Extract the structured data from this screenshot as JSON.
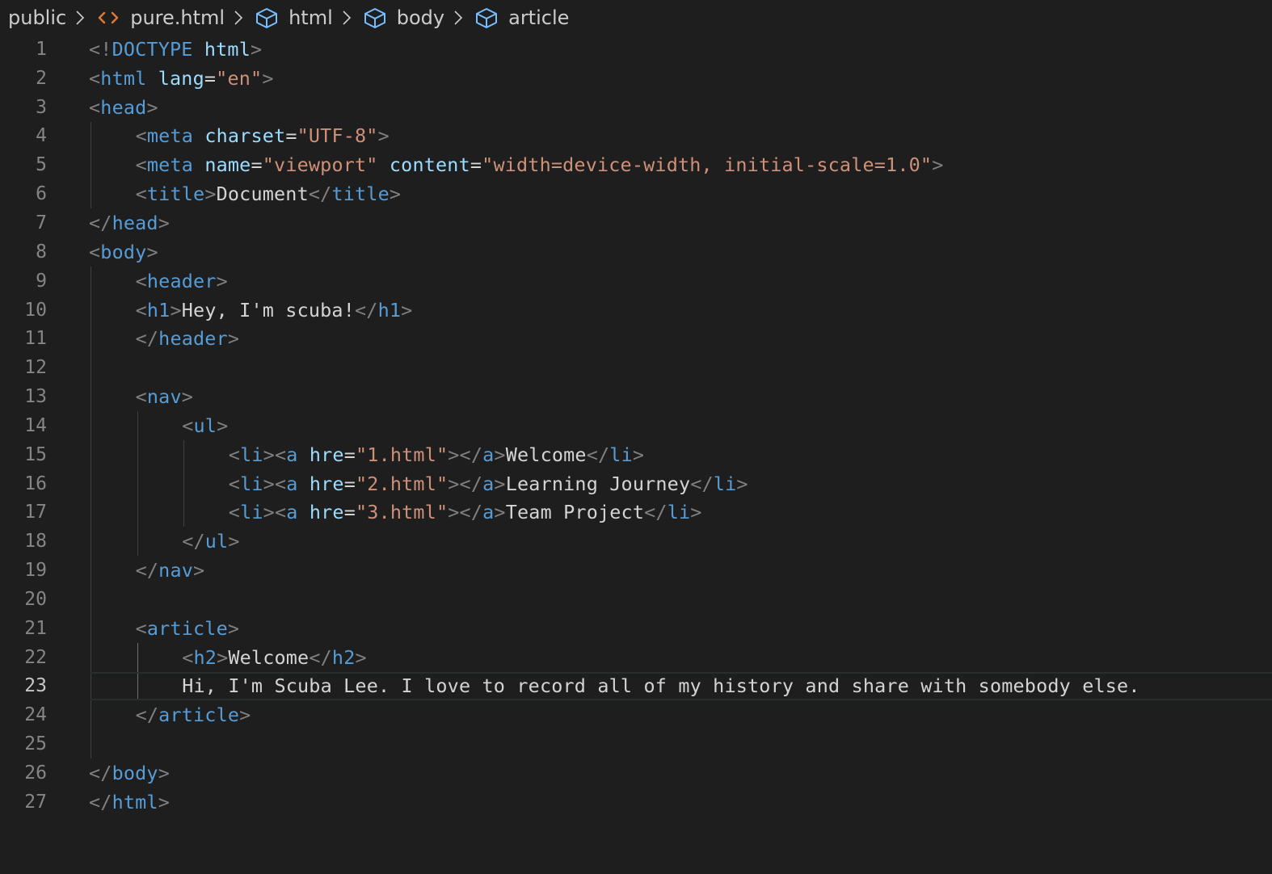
{
  "breadcrumb": {
    "items": [
      {
        "label": "public",
        "icon": "none"
      },
      {
        "label": "pure.html",
        "icon": "html-file-icon"
      },
      {
        "label": "html",
        "icon": "symbol-element-icon"
      },
      {
        "label": "body",
        "icon": "symbol-element-icon"
      },
      {
        "label": "article",
        "icon": "symbol-element-icon"
      }
    ]
  },
  "colors": {
    "background": "#1e1e1e",
    "tag": "#569cd6",
    "attribute": "#9cdcfe",
    "string": "#ce9178",
    "punctuation": "#808080",
    "text": "#d4d4d4",
    "line_number": "#858585",
    "html_icon": "#e37933",
    "symbol_icon": "#75beff"
  },
  "editor": {
    "current_line": 23,
    "lines": [
      {
        "n": "1",
        "indent": 0,
        "tokens": [
          [
            "p",
            "<!"
          ],
          [
            "t",
            "DOCTYPE"
          ],
          [
            "x",
            " "
          ],
          [
            "a",
            "html"
          ],
          [
            "p",
            ">"
          ]
        ]
      },
      {
        "n": "2",
        "indent": 0,
        "tokens": [
          [
            "p",
            "<"
          ],
          [
            "t",
            "html"
          ],
          [
            "x",
            " "
          ],
          [
            "a",
            "lang"
          ],
          [
            "x",
            "="
          ],
          [
            "s",
            "\"en\""
          ],
          [
            "p",
            ">"
          ]
        ]
      },
      {
        "n": "3",
        "indent": 0,
        "tokens": [
          [
            "p",
            "<"
          ],
          [
            "t",
            "head"
          ],
          [
            "p",
            ">"
          ]
        ]
      },
      {
        "n": "4",
        "indent": 1,
        "tokens": [
          [
            "p",
            "<"
          ],
          [
            "t",
            "meta"
          ],
          [
            "x",
            " "
          ],
          [
            "a",
            "charset"
          ],
          [
            "x",
            "="
          ],
          [
            "s",
            "\"UTF-8\""
          ],
          [
            "p",
            ">"
          ]
        ]
      },
      {
        "n": "5",
        "indent": 1,
        "tokens": [
          [
            "p",
            "<"
          ],
          [
            "t",
            "meta"
          ],
          [
            "x",
            " "
          ],
          [
            "a",
            "name"
          ],
          [
            "x",
            "="
          ],
          [
            "s",
            "\"viewport\""
          ],
          [
            "x",
            " "
          ],
          [
            "a",
            "content"
          ],
          [
            "x",
            "="
          ],
          [
            "s",
            "\"width=device-width, initial-scale=1.0\""
          ],
          [
            "p",
            ">"
          ]
        ]
      },
      {
        "n": "6",
        "indent": 1,
        "tokens": [
          [
            "p",
            "<"
          ],
          [
            "t",
            "title"
          ],
          [
            "p",
            ">"
          ],
          [
            "x",
            "Document"
          ],
          [
            "p",
            "</"
          ],
          [
            "t",
            "title"
          ],
          [
            "p",
            ">"
          ]
        ]
      },
      {
        "n": "7",
        "indent": 0,
        "tokens": [
          [
            "p",
            "</"
          ],
          [
            "t",
            "head"
          ],
          [
            "p",
            ">"
          ]
        ]
      },
      {
        "n": "8",
        "indent": 0,
        "tokens": [
          [
            "p",
            "<"
          ],
          [
            "t",
            "body"
          ],
          [
            "p",
            ">"
          ]
        ]
      },
      {
        "n": "9",
        "indent": 1,
        "tokens": [
          [
            "p",
            "<"
          ],
          [
            "t",
            "header"
          ],
          [
            "p",
            ">"
          ]
        ]
      },
      {
        "n": "10",
        "indent": 1,
        "tokens": [
          [
            "p",
            "<"
          ],
          [
            "t",
            "h1"
          ],
          [
            "p",
            ">"
          ],
          [
            "x",
            "Hey, I'm scuba!"
          ],
          [
            "p",
            "</"
          ],
          [
            "t",
            "h1"
          ],
          [
            "p",
            ">"
          ]
        ]
      },
      {
        "n": "11",
        "indent": 1,
        "tokens": [
          [
            "p",
            "</"
          ],
          [
            "t",
            "header"
          ],
          [
            "p",
            ">"
          ]
        ]
      },
      {
        "n": "12",
        "indent": 1,
        "tokens": []
      },
      {
        "n": "13",
        "indent": 1,
        "tokens": [
          [
            "p",
            "<"
          ],
          [
            "t",
            "nav"
          ],
          [
            "p",
            ">"
          ]
        ]
      },
      {
        "n": "14",
        "indent": 2,
        "tokens": [
          [
            "p",
            "<"
          ],
          [
            "t",
            "ul"
          ],
          [
            "p",
            ">"
          ]
        ]
      },
      {
        "n": "15",
        "indent": 3,
        "tokens": [
          [
            "p",
            "<"
          ],
          [
            "t",
            "li"
          ],
          [
            "p",
            "><"
          ],
          [
            "t",
            "a"
          ],
          [
            "x",
            " "
          ],
          [
            "a",
            "hre"
          ],
          [
            "x",
            "="
          ],
          [
            "s",
            "\"1.html\""
          ],
          [
            "p",
            "></"
          ],
          [
            "t",
            "a"
          ],
          [
            "p",
            ">"
          ],
          [
            "x",
            "Welcome"
          ],
          [
            "p",
            "</"
          ],
          [
            "t",
            "li"
          ],
          [
            "p",
            ">"
          ]
        ]
      },
      {
        "n": "16",
        "indent": 3,
        "tokens": [
          [
            "p",
            "<"
          ],
          [
            "t",
            "li"
          ],
          [
            "p",
            "><"
          ],
          [
            "t",
            "a"
          ],
          [
            "x",
            " "
          ],
          [
            "a",
            "hre"
          ],
          [
            "x",
            "="
          ],
          [
            "s",
            "\"2.html\""
          ],
          [
            "p",
            "></"
          ],
          [
            "t",
            "a"
          ],
          [
            "p",
            ">"
          ],
          [
            "x",
            "Learning Journey"
          ],
          [
            "p",
            "</"
          ],
          [
            "t",
            "li"
          ],
          [
            "p",
            ">"
          ]
        ]
      },
      {
        "n": "17",
        "indent": 3,
        "tokens": [
          [
            "p",
            "<"
          ],
          [
            "t",
            "li"
          ],
          [
            "p",
            "><"
          ],
          [
            "t",
            "a"
          ],
          [
            "x",
            " "
          ],
          [
            "a",
            "hre"
          ],
          [
            "x",
            "="
          ],
          [
            "s",
            "\"3.html\""
          ],
          [
            "p",
            "></"
          ],
          [
            "t",
            "a"
          ],
          [
            "p",
            ">"
          ],
          [
            "x",
            "Team Project"
          ],
          [
            "p",
            "</"
          ],
          [
            "t",
            "li"
          ],
          [
            "p",
            ">"
          ]
        ]
      },
      {
        "n": "18",
        "indent": 2,
        "tokens": [
          [
            "p",
            "</"
          ],
          [
            "t",
            "ul"
          ],
          [
            "p",
            ">"
          ]
        ]
      },
      {
        "n": "19",
        "indent": 1,
        "tokens": [
          [
            "p",
            "</"
          ],
          [
            "t",
            "nav"
          ],
          [
            "p",
            ">"
          ]
        ]
      },
      {
        "n": "20",
        "indent": 1,
        "tokens": []
      },
      {
        "n": "21",
        "indent": 1,
        "tokens": [
          [
            "p",
            "<"
          ],
          [
            "t",
            "article"
          ],
          [
            "p",
            ">"
          ]
        ]
      },
      {
        "n": "22",
        "indent": 2,
        "tokens": [
          [
            "p",
            "<"
          ],
          [
            "t",
            "h2"
          ],
          [
            "p",
            ">"
          ],
          [
            "x",
            "Welcome"
          ],
          [
            "p",
            "</"
          ],
          [
            "t",
            "h2"
          ],
          [
            "p",
            ">"
          ]
        ]
      },
      {
        "n": "23",
        "indent": 2,
        "tokens": [
          [
            "x",
            "Hi, I'm Scuba Lee. I love to record all of my history and share with somebody else."
          ]
        ]
      },
      {
        "n": "24",
        "indent": 1,
        "tokens": [
          [
            "p",
            "</"
          ],
          [
            "t",
            "article"
          ],
          [
            "p",
            ">"
          ]
        ]
      },
      {
        "n": "25",
        "indent": 1,
        "tokens": []
      },
      {
        "n": "26",
        "indent": 0,
        "tokens": [
          [
            "p",
            "</"
          ],
          [
            "t",
            "body"
          ],
          [
            "p",
            ">"
          ]
        ]
      },
      {
        "n": "27",
        "indent": 0,
        "tokens": [
          [
            "p",
            "</"
          ],
          [
            "t",
            "html"
          ],
          [
            "p",
            ">"
          ]
        ]
      }
    ]
  }
}
